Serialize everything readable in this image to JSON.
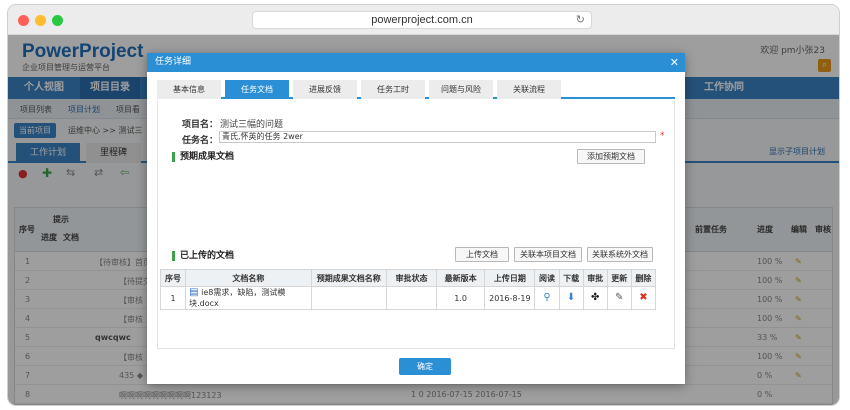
{
  "browser": {
    "url": "powerproject.com.cn"
  },
  "app": {
    "logo": "PowerProject",
    "slogan": "企业项目管理与运营平台",
    "welcome": "欢迎 pm小张23",
    "nav": [
      "个人视图",
      "项目目录",
      "工作协同"
    ],
    "subnav": [
      "项目列表",
      "项目计划",
      "项目看"
    ],
    "crumb_pill": "当前项目",
    "crumb_text": "运维中心 >> 测试三",
    "plan_tabs": [
      "工作计划",
      "里程碑"
    ],
    "show_sub": "显示子项目计划",
    "grid_headers": {
      "seq": "序号",
      "hint": "提示",
      "progress": "进度",
      "doc": "文档",
      "pre": "前置任务",
      "prog2": "进度",
      "edit": "编辑",
      "audit": "审核"
    },
    "grid_rows": [
      {
        "n": "1",
        "name": "【待审核】首页",
        "pct": "100 %"
      },
      {
        "n": "2",
        "name": "【待提交",
        "pct": "100 %"
      },
      {
        "n": "3",
        "name": "【审核",
        "pct": "100 %"
      },
      {
        "n": "4",
        "name": "【审核",
        "pct": "100 %"
      },
      {
        "n": "5",
        "name": "qwcqwc",
        "pct": "33 %"
      },
      {
        "n": "6",
        "name": "【审核",
        "pct": "100 %"
      },
      {
        "n": "7",
        "name": "435 ◆",
        "pct": "0 %"
      },
      {
        "n": "8",
        "name": "啊啊啊啊啊啊啊啊啊123123",
        "pct": "0 %",
        "extra": "1   0   2016-07-15   2016-07-15"
      }
    ]
  },
  "dialog": {
    "title": "任务详细",
    "tabs": [
      "基本信息",
      "任务文档",
      "进展反馈",
      "任务工时",
      "问题与风险",
      "关联流程"
    ],
    "active_tab": 1,
    "project_label": "项目名：",
    "project_value": "测试三幅的问题",
    "task_label": "任务名：",
    "task_value": "青氏,怀英的任务 2wer",
    "section_expected": "预期成果文档",
    "add_expected_btn": "添加预期文档",
    "section_uploaded": "已上传的文档",
    "upload_btn": "上传文档",
    "link_project_btn": "关联本项目文档",
    "link_external_btn": "关联系统外文档",
    "columns": [
      "序号",
      "文档名称",
      "预期成果文档名称",
      "审批状态",
      "最新版本",
      "上传日期",
      "阅读",
      "下载",
      "审批",
      "更新",
      "删除"
    ],
    "rows": [
      {
        "seq": "1",
        "name": "ie8需求，缺陷，测试模块.docx",
        "expected": "",
        "status": "",
        "version": "1.0",
        "date": "2016-8-19"
      }
    ],
    "ok": "确定"
  }
}
